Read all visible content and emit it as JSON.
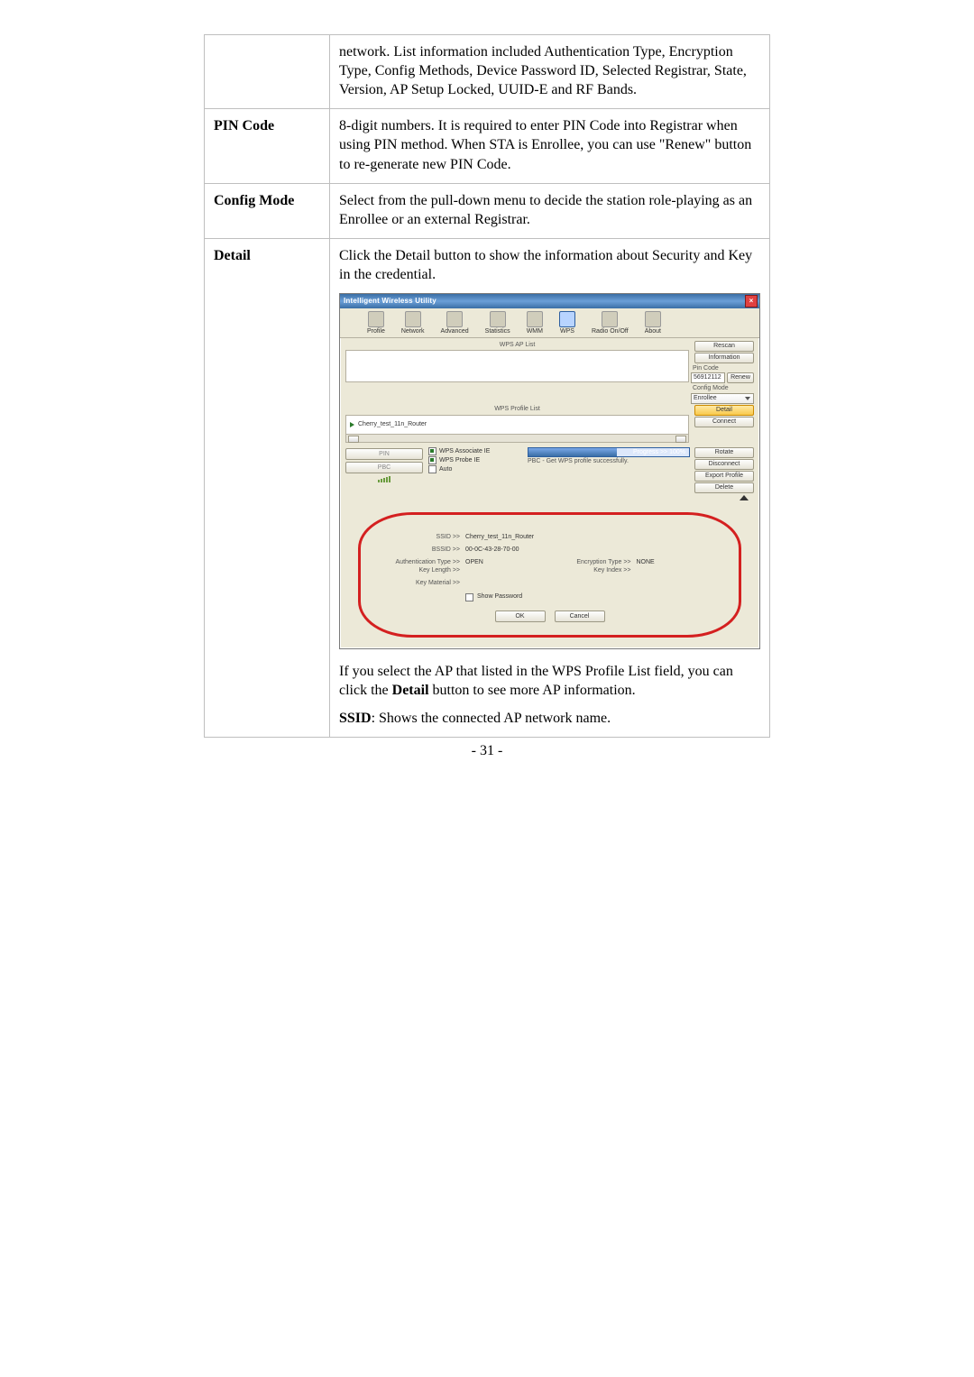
{
  "page_number": "- 31 -",
  "rows": {
    "r0_label": "",
    "r0_text": "network. List information included Authentication Type, Encryption Type, Config Methods, Device Password ID, Selected Registrar, State, Version, AP Setup Locked, UUID-E and RF Bands.",
    "r1_label": "PIN Code",
    "r1_text": "8-digit numbers. It is required to enter PIN Code into Registrar when using PIN method. When STA is Enrollee, you can use \"Renew\" button to re-generate new PIN Code.",
    "r2_label": "Config Mode",
    "r2_text": "Select from the pull-down menu to decide the station role-playing as an Enrollee or an external Registrar.",
    "r3_label": "Detail",
    "r3_intro": "Click the Detail button to show the information about Security and Key in the credential.",
    "r3_after1_a": "If you select the AP that listed in the WPS Profile List field, you can click the ",
    "r3_after1_bold": "Detail",
    "r3_after1_b": " button to see more AP information.",
    "r3_ssid_bold": "SSID",
    "r3_ssid_rest": ": Shows the connected AP network name."
  },
  "shot": {
    "title": "Intelligent Wireless Utility",
    "toolbar": [
      "Profile",
      "Network",
      "Advanced",
      "Statistics",
      "WMM",
      "WPS",
      "Radio On/Off",
      "About"
    ],
    "wps_ap_list_title": "WPS AP List",
    "btn_rescan": "Rescan",
    "btn_information": "Information",
    "lab_pincode": "Pin Code",
    "pincode": "56912112",
    "btn_renew": "Renew",
    "lab_configmode": "Config Mode",
    "configmode_value": "Enrollee",
    "wps_profile_title": "WPS Profile List",
    "profile_entry": "Cherry_test_11n_Router",
    "btn_detail": "Detail",
    "btn_connect": "Connect",
    "btn_rotate": "Rotate",
    "btn_disconnect": "Disconnect",
    "btn_export": "Export Profile",
    "btn_delete": "Delete",
    "pin_btn": "PIN",
    "pbc_btn": "PBC",
    "chk_assoc": "WPS Associate IE",
    "chk_probe": "WPS Probe IE",
    "chk_auto": "Auto",
    "progress_label": "Progress >> 100%",
    "progress_sub": "PBC - Get WPS profile successfully.",
    "detail": {
      "ssid_l": "SSID >>",
      "ssid_v": "Cherry_test_11n_Router",
      "bssid_l": "BSSID >>",
      "bssid_v": "00-0C-43-28-70-00",
      "auth_l": "Authentication Type >>",
      "auth_v": "OPEN",
      "enc_l": "Encryption Type >>",
      "enc_v": "NONE",
      "keylen_l": "Key Length >>",
      "keyidx_l": "Key Index >>",
      "keymat_l": "Key Material >>",
      "showpw": "Show Password",
      "ok": "OK",
      "cancel": "Cancel"
    }
  }
}
